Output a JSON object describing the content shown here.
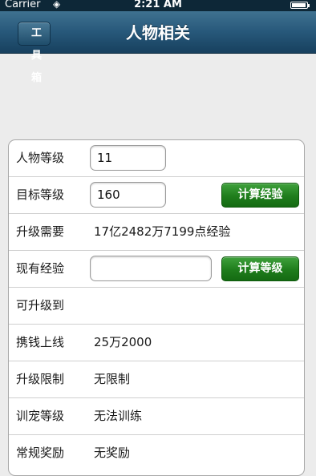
{
  "status_bar": {
    "carrier": "Carrier",
    "time": "2:21 AM"
  },
  "nav": {
    "back_label": "工具箱",
    "title": "人物相关"
  },
  "rows": {
    "char_level": {
      "label": "人物等级",
      "value": "11"
    },
    "target_level": {
      "label": "目标等级",
      "value": "160",
      "button": "计算经验"
    },
    "upgrade_need": {
      "label": "升级需要",
      "value": "17亿2482万7199点经验"
    },
    "current_exp": {
      "label": "现有经验",
      "value": "",
      "button": "计算等级"
    },
    "can_reach": {
      "label": "可升级到",
      "value": ""
    },
    "money_cap": {
      "label": "携钱上线",
      "value": "25万2000"
    },
    "upgrade_limit": {
      "label": "升级限制",
      "value": "无限制"
    },
    "pet_level": {
      "label": "训宠等级",
      "value": "无法训练"
    },
    "regular_reward": {
      "label": "常规奖励",
      "value": "无奖励"
    }
  }
}
